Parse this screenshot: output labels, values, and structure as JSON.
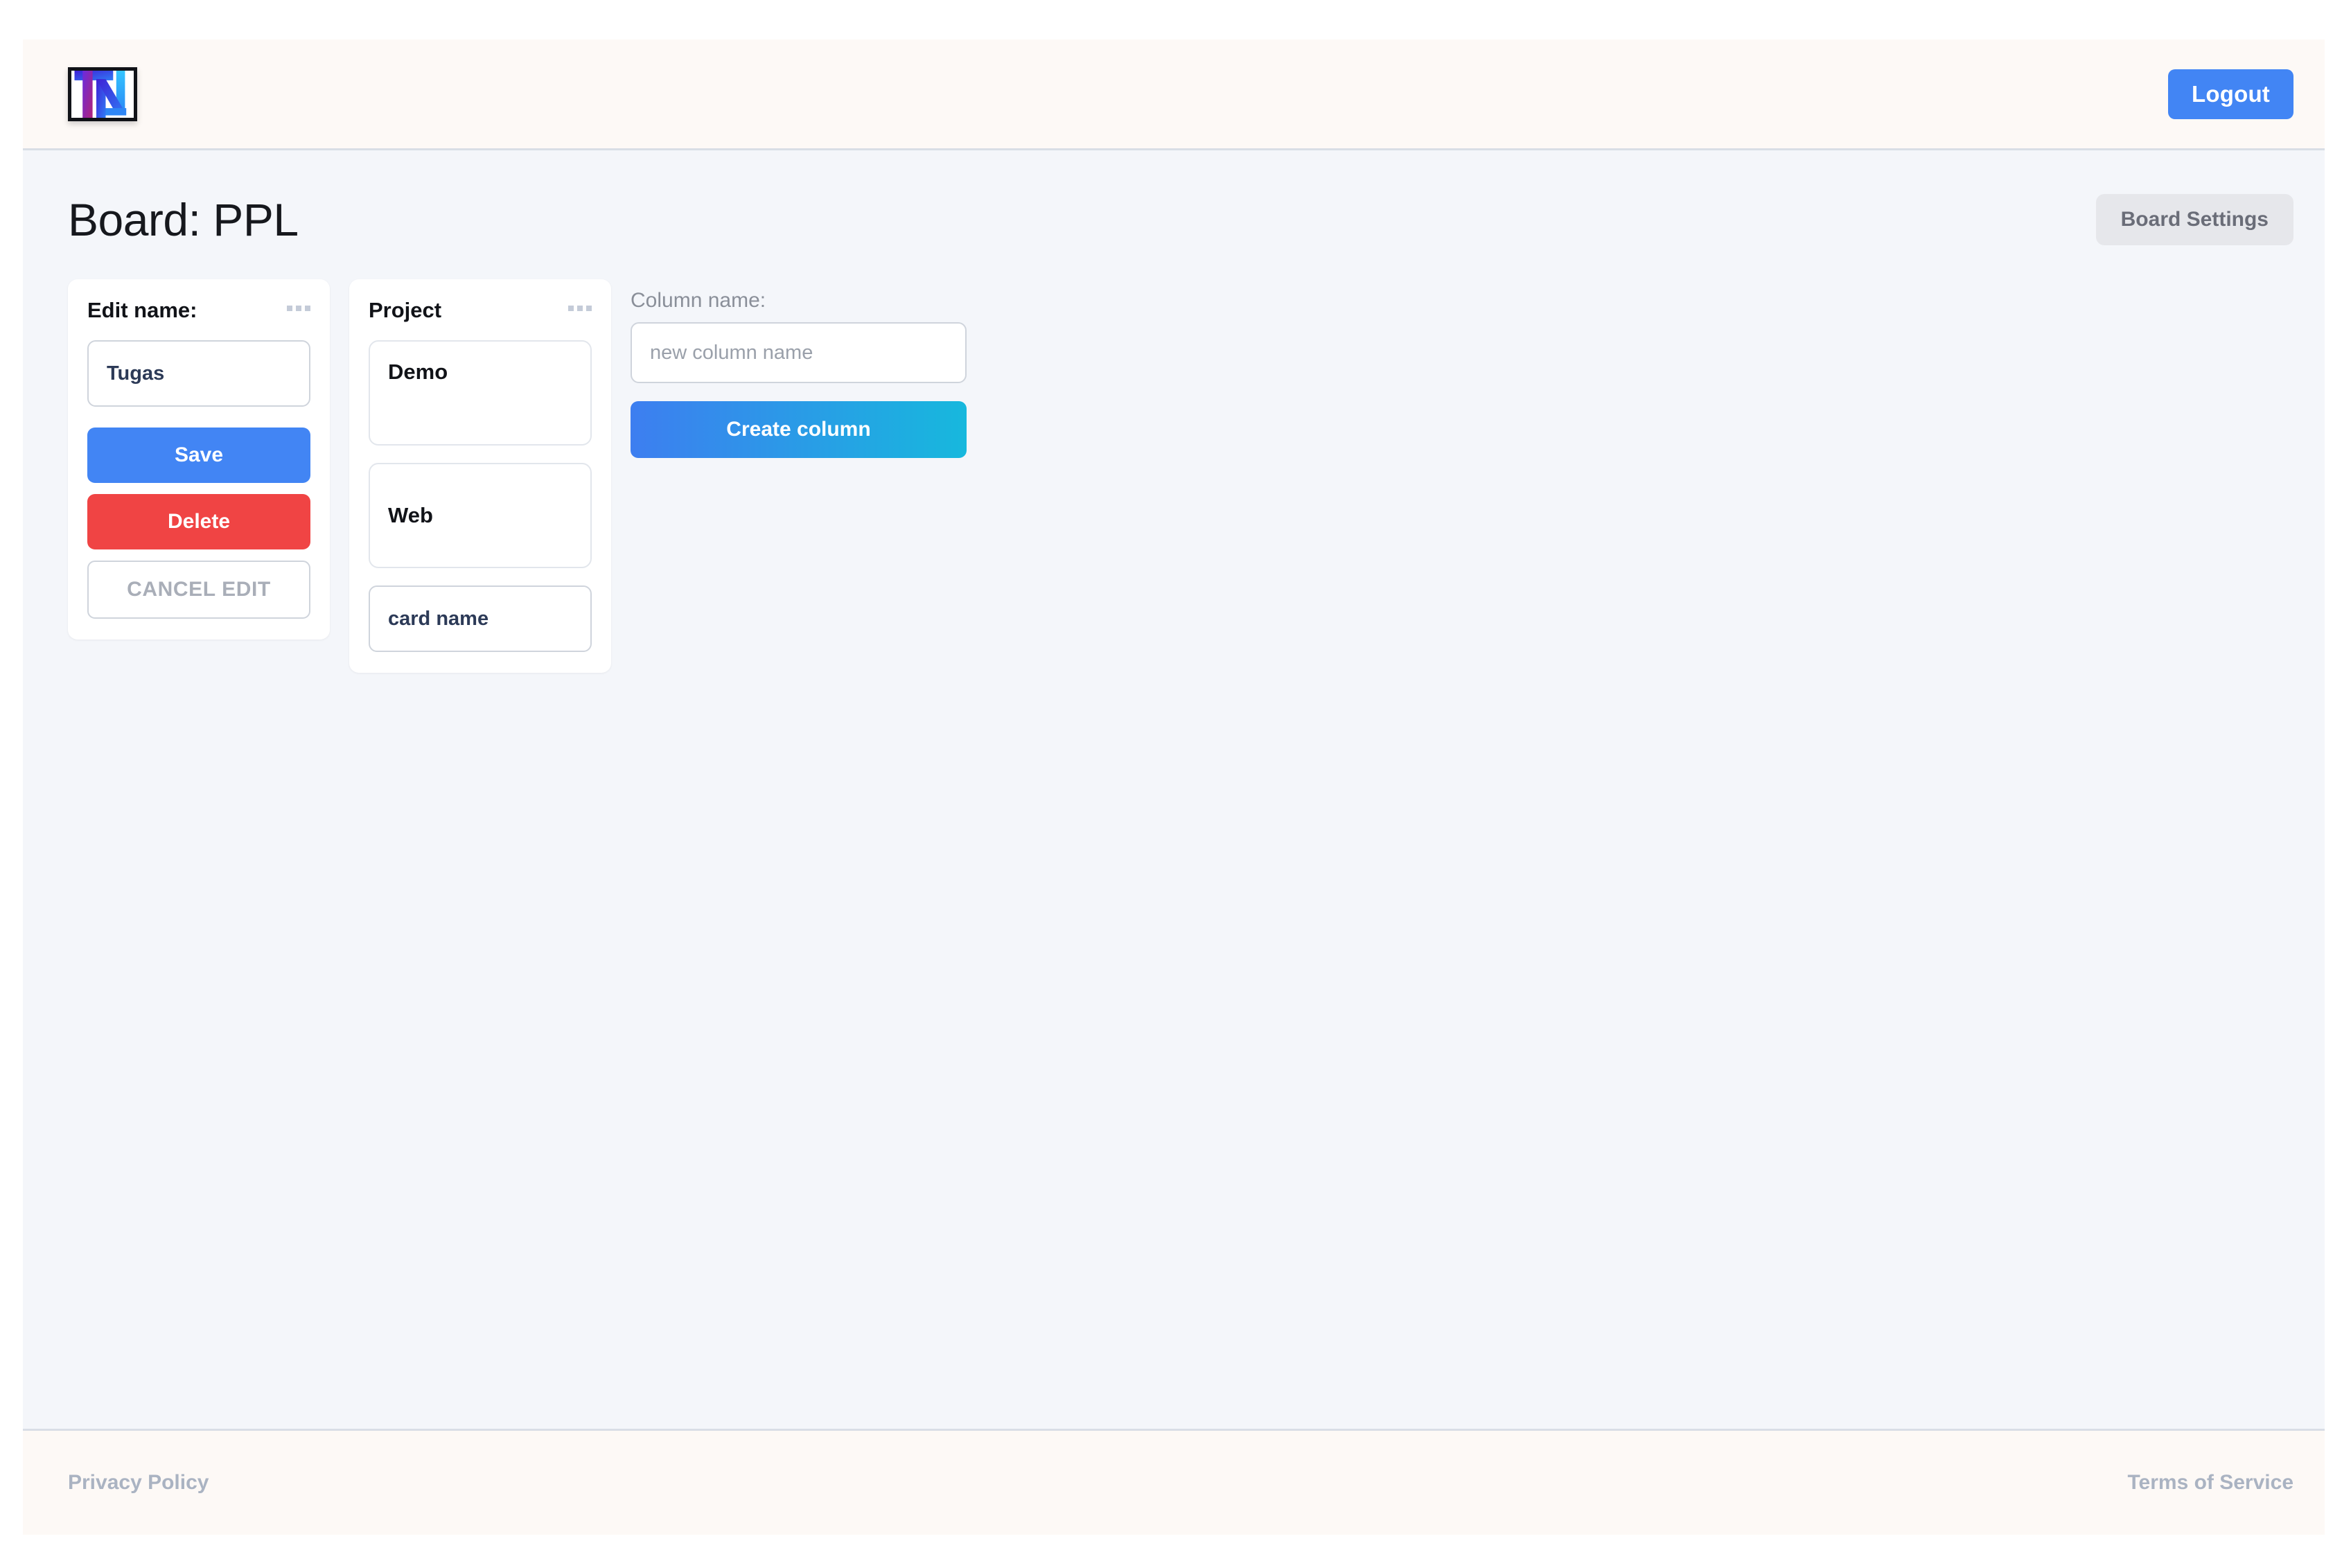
{
  "header": {
    "logo_alt": "TN",
    "logout_label": "Logout"
  },
  "page": {
    "title": "Board: PPL",
    "board_settings_label": "Board Settings"
  },
  "columns": [
    {
      "title": "Edit name:",
      "menu_icon": "ellipsis-icon",
      "name_value": "Tugas",
      "name_placeholder": "",
      "save_label": "Save",
      "delete_label": "Delete",
      "cancel_label": "CANCEL EDIT"
    },
    {
      "title": "Project",
      "menu_icon": "ellipsis-icon",
      "cards": [
        {
          "label": "Demo"
        },
        {
          "label": "Web"
        }
      ],
      "card_input_value": "card name",
      "card_input_placeholder": "card name"
    }
  ],
  "create_column": {
    "label": "Column name:",
    "input_value": "",
    "input_placeholder": "new column name",
    "button_label": "Create column"
  },
  "footer": {
    "privacy_label": "Privacy Policy",
    "terms_label": "Terms of Service"
  },
  "colors": {
    "accent_blue": "#4285f4",
    "danger_red": "#f04444",
    "gradient_start": "#3d7ef0",
    "gradient_end": "#17b8dd",
    "header_bg": "#fdf9f6",
    "main_bg": "#f4f6fa",
    "muted_text": "#aab3c2"
  }
}
